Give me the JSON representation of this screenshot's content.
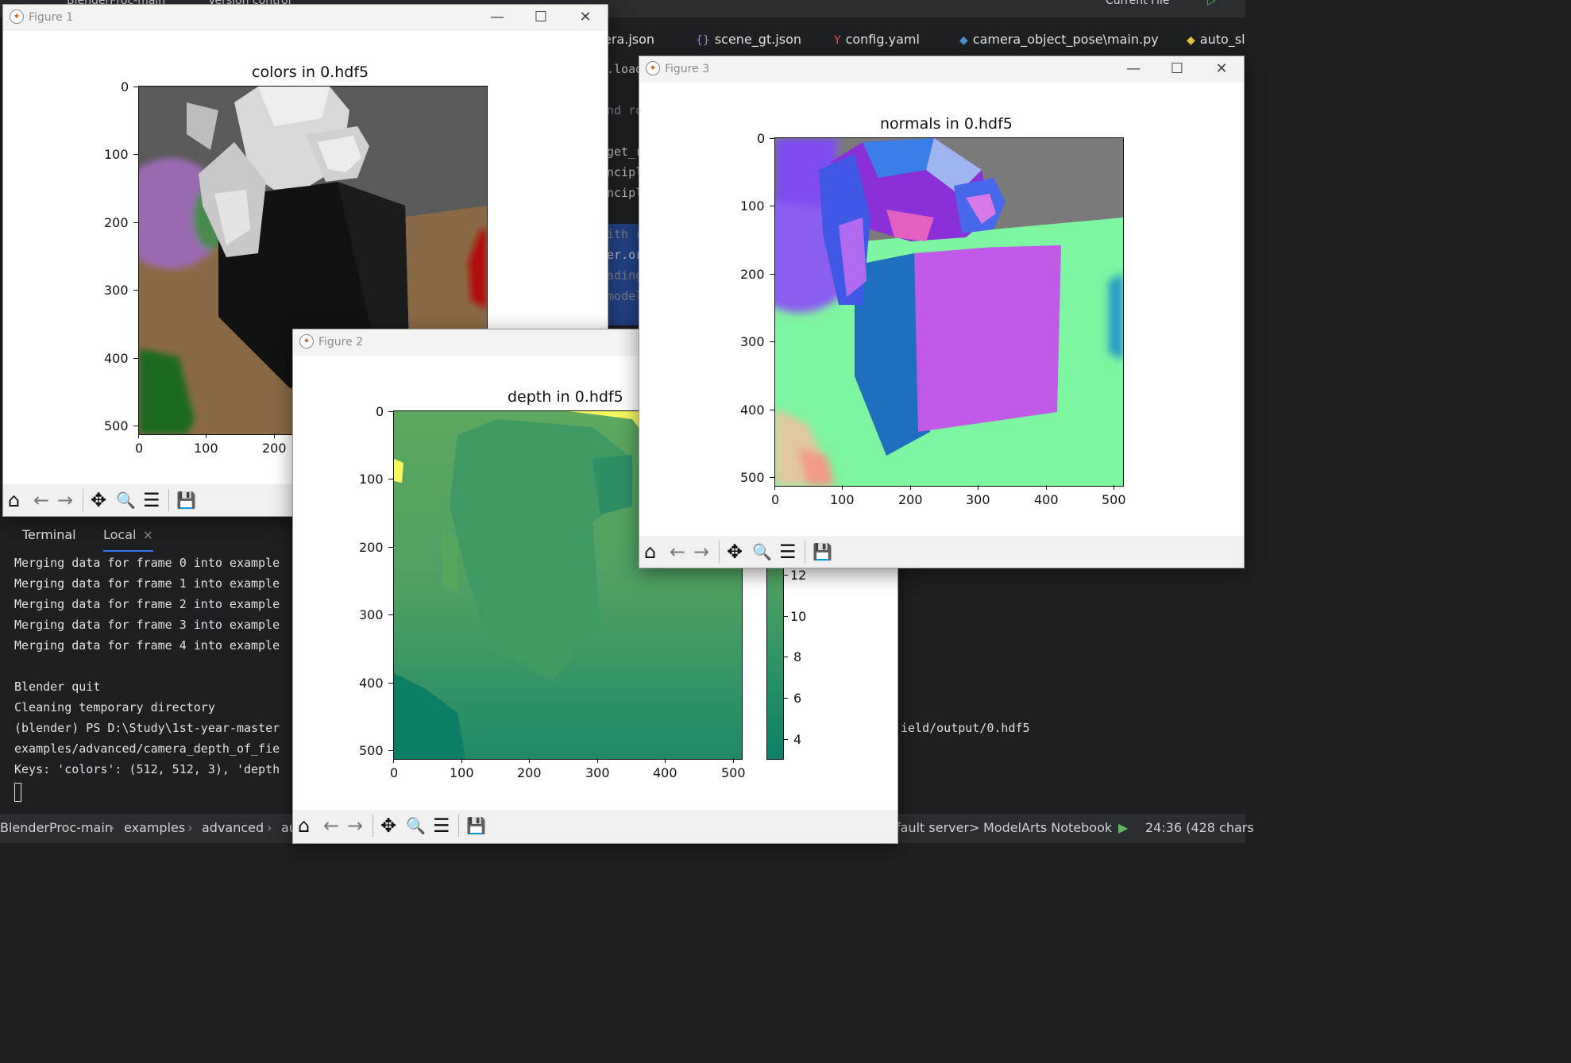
{
  "ide": {
    "topbar": {
      "project": "BlenderProc-main",
      "vcs": "Version control",
      "run_config": "Current File"
    },
    "tabs": [
      {
        "label": "era.json",
        "icon": "json-file-icon"
      },
      {
        "label": "scene_gt.json",
        "icon": "json-file-icon"
      },
      {
        "label": "config.yaml",
        "icon": "yaml-file-icon"
      },
      {
        "label": "camera_object_pose\\main.py",
        "icon": "python-file-icon"
      },
      {
        "label": "auto_sl",
        "icon": "python-file-icon"
      }
    ],
    "code_fragments": [
      ".load",
      "nd ro",
      "get_r",
      "ncipl",
      "ncipl",
      "ith r",
      "er.or",
      "ading",
      "model"
    ],
    "terminal": {
      "tab_terminal": "Terminal",
      "tab_local": "Local",
      "lines": [
        "Merging data for frame 0 into example",
        "Merging data for frame 1 into example",
        "Merging data for frame 2 into example",
        "Merging data for frame 3 into example",
        "Merging data for frame 4 into example",
        "",
        "Blender quit",
        "Cleaning temporary directory",
        "(blender) PS D:\\Study\\1st-year-master",
        "examples/advanced/camera_depth_of_fie",
        "Keys: 'colors': (512, 512, 3), 'depth"
      ],
      "line_tail": "ield/output/0.hdf5"
    },
    "statusbar": {
      "breadcrumb": [
        "BlenderProc-main",
        "examples",
        "advanced",
        "au"
      ],
      "interpreter": "fault server>",
      "notebook": "ModelArts Notebook",
      "position": "24:36 (428 chars"
    }
  },
  "figures": {
    "fig1": {
      "window_title": "Figure 1",
      "plot_title": "colors in 0.hdf5",
      "y_ticks": [
        "0",
        "100",
        "200",
        "300",
        "400",
        "500"
      ],
      "x_ticks": [
        "0",
        "100",
        "200"
      ]
    },
    "fig2": {
      "window_title": "Figure 2",
      "plot_title": "depth in 0.hdf5",
      "y_ticks": [
        "0",
        "100",
        "200",
        "300",
        "400",
        "500"
      ],
      "x_ticks": [
        "0",
        "100",
        "200",
        "300",
        "400",
        "500"
      ],
      "colorbar_ticks": [
        "12",
        "10",
        "8",
        "6",
        "4"
      ]
    },
    "fig3": {
      "window_title": "Figure 3",
      "plot_title": "normals in 0.hdf5",
      "y_ticks": [
        "0",
        "100",
        "200",
        "300",
        "400",
        "500"
      ],
      "x_ticks": [
        "0",
        "100",
        "200",
        "300",
        "400",
        "500"
      ]
    }
  },
  "window_controls": {
    "minimize": "—",
    "maximize": "☐",
    "close": "✕"
  },
  "toolbar_icons": {
    "home": "⌂",
    "back": "←",
    "forward": "→",
    "pan": "✥",
    "zoom": "🔍",
    "configure": "☰",
    "save": "💾"
  },
  "colors": {
    "depth_colormap": [
      "#00796b",
      "#3f9d5e",
      "#77b85b",
      "#ffff66"
    ],
    "normals_floor": "#7ef5a0",
    "normals_box_front": "#1f6fbf",
    "normals_box_right": "#c15ae6"
  }
}
